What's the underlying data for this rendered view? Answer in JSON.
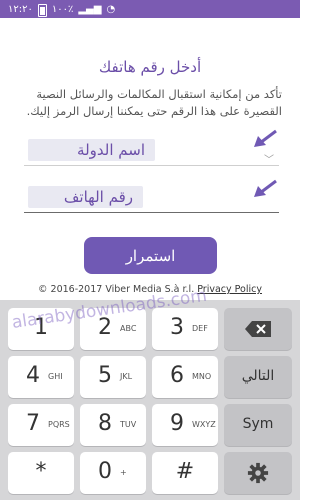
{
  "status_bar": {
    "time": "١٢:٢٠",
    "battery_percent": "١٠٠٪"
  },
  "screen": {
    "title": "أدخل رقم هاتفك",
    "description": "تأكد من إمكانية استقبال المكالمات والرسائل النصية القصيرة على هذا الرقم حتى يمكننا إرسال الرمز إليك.",
    "country_field": "اسم الدولة",
    "phone_field": "رقم الهاتف",
    "continue_label": "استمرار",
    "footer_text": "© 2016-2017 Viber Media S.à r.l.",
    "privacy_link": "Privacy Policy"
  },
  "watermark": "alarabydownloads.com",
  "keyboard": {
    "keys": [
      {
        "num": "1",
        "letters": ""
      },
      {
        "num": "2",
        "letters": "ABC"
      },
      {
        "num": "3",
        "letters": "DEF"
      },
      {
        "num": "4",
        "letters": "GHI"
      },
      {
        "num": "5",
        "letters": "JKL"
      },
      {
        "num": "6",
        "letters": "MNO"
      },
      {
        "num": "7",
        "letters": "PQRS"
      },
      {
        "num": "8",
        "letters": "TUV"
      },
      {
        "num": "9",
        "letters": "WXYZ"
      },
      {
        "num": "*",
        "letters": ""
      },
      {
        "num": "0",
        "letters": "+"
      },
      {
        "num": "#",
        "letters": ""
      }
    ],
    "next_label": "التالي",
    "sym_label": "Sym"
  },
  "colors": {
    "accent": "#7059b4",
    "status_bar": "#7b5bb2"
  }
}
